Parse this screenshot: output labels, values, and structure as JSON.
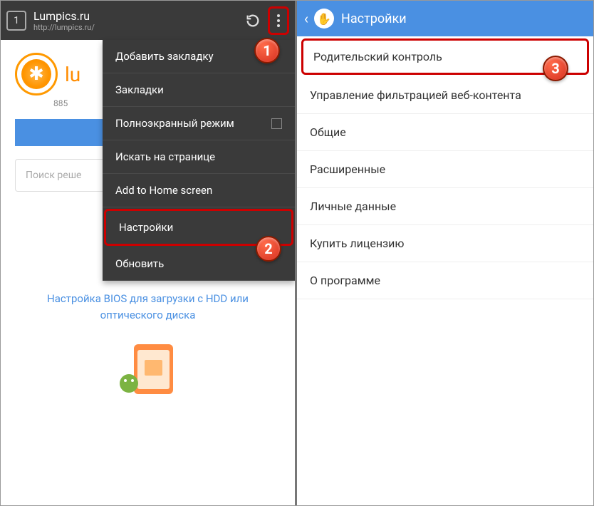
{
  "left": {
    "tab_count": "1",
    "title": "Lumpics.ru",
    "url": "http://lumpics.ru/",
    "site_name": "lu",
    "site_sub": "885",
    "search_placeholder": "Поиск реше",
    "article_text": "Настройка BIOS для загрузки с HDD или оптического диска",
    "menu": {
      "add_bookmark": "Добавить закладку",
      "bookmarks": "Закладки",
      "fullscreen": "Полноэкранный режим",
      "find": "Искать на странице",
      "add_home": "Add to Home screen",
      "settings": "Настройки",
      "refresh": "Обновить"
    }
  },
  "right": {
    "header": "Настройки",
    "items": {
      "parental": "Родительский контроль",
      "filter": "Управление фильтрацией веб-контента",
      "general": "Общие",
      "advanced": "Расширенные",
      "personal": "Личные данные",
      "buy": "Купить лицензию",
      "about": "О программе"
    }
  },
  "badges": {
    "b1": "1",
    "b2": "2",
    "b3": "3"
  }
}
